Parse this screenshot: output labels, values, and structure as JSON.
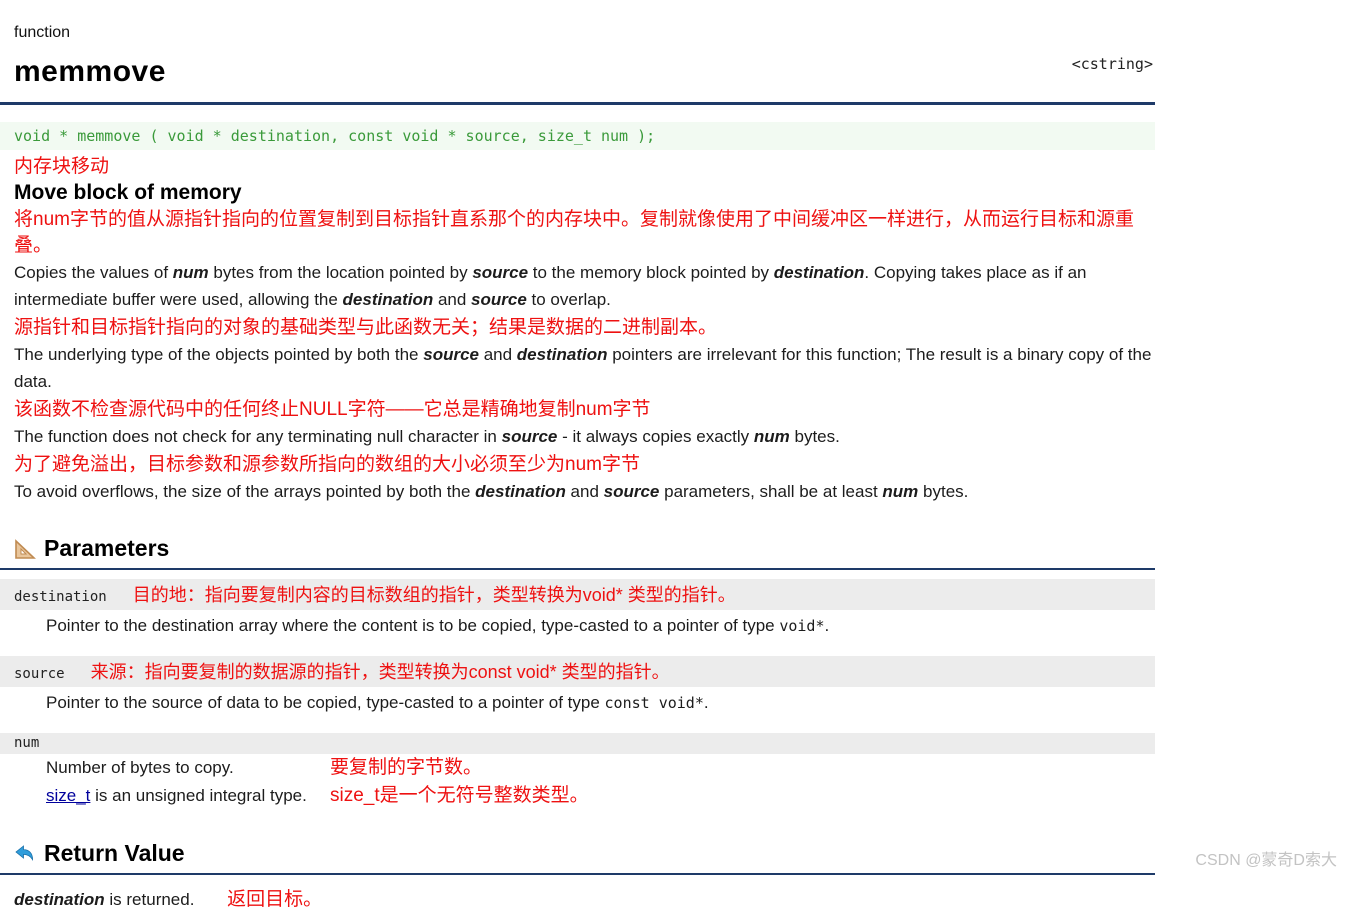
{
  "colors": {
    "accent_rule": "#1e3a68",
    "annotation_red": "#ee1111",
    "code_green": "#3a9a3a",
    "code_background": "#f2faf2",
    "param_strip_gray": "#ececec",
    "link_blue": "#00009c",
    "return_icon_blue": "#2f9ddb",
    "parameters_icon_tan": "#d8a878",
    "watermark_gray": "#c3c3c3"
  },
  "header": {
    "kicker": "function",
    "title": "memmove",
    "include": "<cstring>"
  },
  "declaration": "void * memmove ( void * destination, const void * source, size_t num );",
  "intro": {
    "zh_title": "内存块移动",
    "en_title": "Move block of memory",
    "paragraphs": [
      {
        "zh": "将num字节的值从源指针指向的位置复制到目标指针直系那个的内存块中。复制就像使用了中间缓冲区一样进行，从而运行目标和源重叠。",
        "en": [
          [
            "Copies the values of "
          ],
          [
            "num",
            "bi"
          ],
          [
            " bytes from the location pointed by "
          ],
          [
            "source",
            "bi"
          ],
          [
            " to the memory block pointed by "
          ],
          [
            "destination",
            "bi"
          ],
          [
            ". Copying takes place as if an intermediate buffer were used, allowing the "
          ],
          [
            "destination",
            "bi"
          ],
          [
            " and "
          ],
          [
            "source",
            "bi"
          ],
          [
            " to overlap."
          ]
        ]
      },
      {
        "zh": "源指针和目标指针指向的对象的基础类型与此函数无关；结果是数据的二进制副本。",
        "en": [
          [
            "The underlying type of the objects pointed by both the "
          ],
          [
            "source",
            "bi"
          ],
          [
            " and "
          ],
          [
            "destination",
            "bi"
          ],
          [
            " pointers are irrelevant for this function; The result is a binary copy of the data."
          ]
        ]
      },
      {
        "zh": "该函数不检查源代码中的任何终止NULL字符——它总是精确地复制num字节",
        "en": [
          [
            "The function does not check for any terminating null character in "
          ],
          [
            "source",
            "bi"
          ],
          [
            " - it always copies exactly "
          ],
          [
            "num",
            "bi"
          ],
          [
            " bytes."
          ]
        ]
      },
      {
        "zh": "为了避免溢出，目标参数和源参数所指向的数组的大小必须至少为num字节",
        "en": [
          [
            "To avoid overflows, the size of the arrays pointed by both the "
          ],
          [
            "destination",
            "bi"
          ],
          [
            " and "
          ],
          [
            "source",
            "bi"
          ],
          [
            " parameters, shall be at least "
          ],
          [
            "num",
            "bi"
          ],
          [
            " bytes."
          ]
        ]
      }
    ]
  },
  "parameters": {
    "heading": "Parameters",
    "icon": "set-square-icon",
    "rows": [
      {
        "name": "destination",
        "zh": "目的地：指向要复制内容的目标数组的指针，类型转换为void* 类型的指针。",
        "desc": [
          [
            "Pointer to the destination array where the content is to be copied, type-casted to a pointer of type "
          ],
          [
            "void*",
            "code"
          ],
          [
            "."
          ]
        ]
      },
      {
        "name": "source",
        "zh": "来源：指向要复制的数据源的指针，类型转换为const void* 类型的指针。",
        "desc": [
          [
            "Pointer to the source of data to be copied, type-casted to a pointer of type "
          ],
          [
            "const void*",
            "code"
          ],
          [
            "."
          ]
        ]
      },
      {
        "name": "num",
        "zh": "",
        "desc_lines": [
          {
            "en": [
              [
                "Number of bytes to copy."
              ]
            ],
            "zh": "要复制的字节数。"
          },
          {
            "en": [
              [
                "size_t",
                "link"
              ],
              [
                " is an unsigned integral type."
              ]
            ],
            "zh": "size_t是一个无符号整数类型。"
          }
        ]
      }
    ]
  },
  "return_value": {
    "heading": "Return Value",
    "icon": "return-arrow-icon",
    "body": [
      [
        "destination",
        "bi"
      ],
      [
        " is returned."
      ]
    ],
    "zh": "返回目标。"
  },
  "watermark": "CSDN @蒙奇D索大"
}
